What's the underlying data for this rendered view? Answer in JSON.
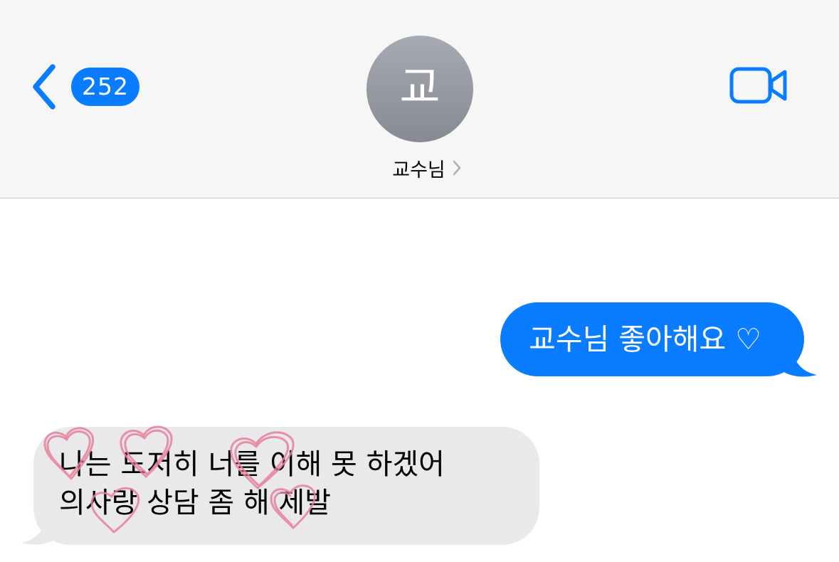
{
  "header": {
    "back_badge": "252",
    "avatar_initial": "교",
    "contact_name": "교수님"
  },
  "messages": {
    "outgoing_text": "교수님 좋아해요 ♡",
    "incoming_lines": [
      "나는 도저히 너를 이해 못 하겠어",
      "의사랑 상담 좀 해 제발"
    ]
  },
  "icons": {
    "back": "chevron-left-icon",
    "video": "video-camera-icon",
    "contact_detail": "chevron-right-icon",
    "decoration": "heart-doodle-icon"
  },
  "colors": {
    "accent": "#0a7cff",
    "header_background": "#f6f6f6",
    "incoming_bubble": "#e9e9eb",
    "avatar": "#979aa3",
    "heart_doodle": "#e8809a"
  }
}
